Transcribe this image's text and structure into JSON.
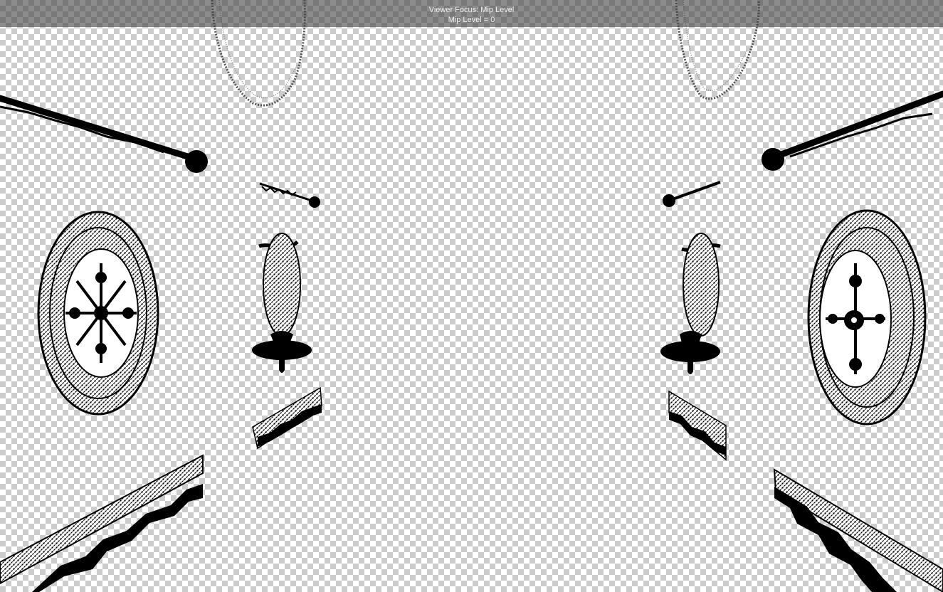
{
  "viewer": {
    "focus_title": "Viewer Focus: Mip Level",
    "mip_level_text": "Mip Level = 0"
  },
  "texture": {
    "background": "transparent-checkerboard",
    "ink_color": "#000000",
    "checker_color": "#cccccc"
  }
}
